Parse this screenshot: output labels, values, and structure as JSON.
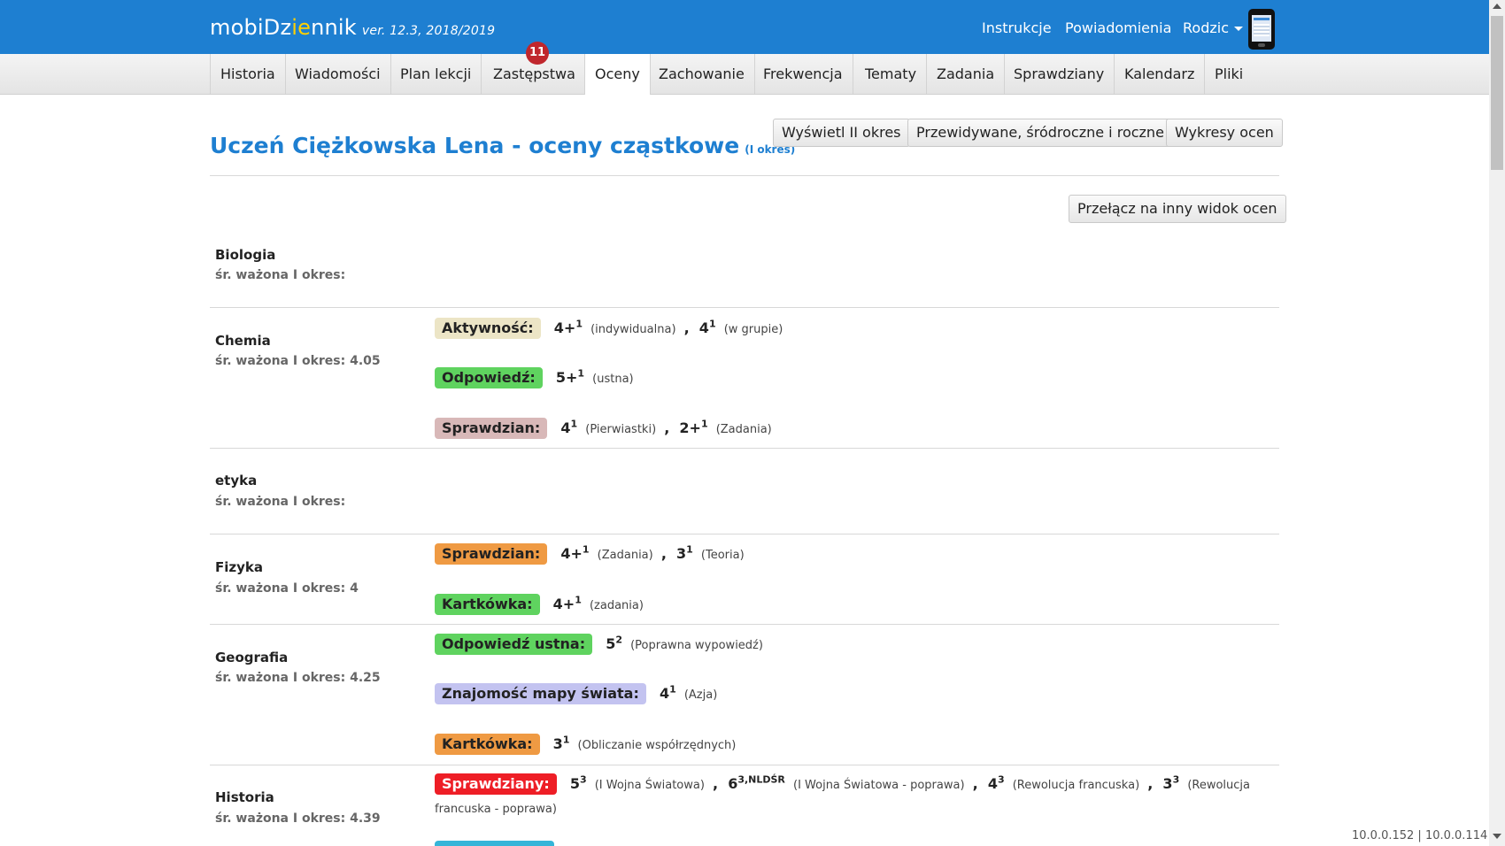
{
  "header": {
    "brand_a": "mobiDz",
    "brand_b": "ie",
    "brand_c": "nnik",
    "version": "ver. 12.3, 2018/2019",
    "links": [
      "Instrukcje",
      "Powiadomienia"
    ],
    "user_menu": "Rodzic"
  },
  "tabs": [
    "Historia",
    "Wiadomości",
    "Plan lekcji",
    "Zastępstwa",
    "Oceny",
    "Zachowanie",
    "Frekwencja",
    "Tematy",
    "Zadania",
    "Sprawdziany",
    "Kalendarz",
    "Pliki"
  ],
  "active_tab": "Oceny",
  "badge": "11",
  "page": {
    "title": "Uczeń Ciężkowska Lena - oceny cząstkowe",
    "period": "(I okres)",
    "btn_period2": "Wyświetl II okres",
    "btn_predicted": "Przewidywane, śródroczne i roczne",
    "btn_charts": "Wykresy ocen",
    "btn_switch": "Przełącz na inny widok ocen"
  },
  "subjects": [
    {
      "name": "Biologia",
      "avg": "śr. ważona I okres:"
    },
    {
      "name": "Chemia",
      "avg": "śr. ważona I okres: 4.05"
    },
    {
      "name": "etyka",
      "avg": "śr. ważona I okres:"
    },
    {
      "name": "Fizyka",
      "avg": "śr. ważona I okres: 4"
    },
    {
      "name": "Geografia",
      "avg": "śr. ważona I okres: 4.25"
    },
    {
      "name": "Historia",
      "avg": "śr. ważona I okres: 4.39"
    }
  ],
  "grades": {
    "chem_akt": {
      "cat": "Aktywność:",
      "g1": "4+",
      "w1": "1",
      "d1": "(indywidualna)",
      "g2": "4",
      "w2": "1",
      "d2": "(w grupie)"
    },
    "chem_odp": {
      "cat": "Odpowiedź:",
      "g1": "5+",
      "w1": "1",
      "d1": "(ustna)"
    },
    "chem_spr": {
      "cat": "Sprawdzian:",
      "g1": "4",
      "w1": "1",
      "d1": "(Pierwiastki)",
      "g2": "2+",
      "w2": "1",
      "d2": "(Zadania)"
    },
    "fiz_spr": {
      "cat": "Sprawdzian:",
      "g1": "4+",
      "w1": "1",
      "d1": "(Zadania)",
      "g2": "3",
      "w2": "1",
      "d2": "(Teoria)"
    },
    "fiz_kart": {
      "cat": "Kartkówka:",
      "g1": "4+",
      "w1": "1",
      "d1": "(zadania)"
    },
    "geo_odp": {
      "cat": "Odpowiedź ustna:",
      "g1": "5",
      "w1": "2",
      "d1": "(Poprawna wypowiedź)"
    },
    "geo_mapa": {
      "cat": "Znajomość mapy świata:",
      "g1": "4",
      "w1": "1",
      "d1": "(Azja)"
    },
    "geo_kart": {
      "cat": "Kartkówka:",
      "g1": "3",
      "w1": "1",
      "d1": "(Obliczanie współrzędnych)"
    },
    "hist_spr": {
      "cat": "Sprawdziany:",
      "g1": "5",
      "w1": "3",
      "d1": "(I Wojna Światowa)",
      "g2": "6",
      "w2": "3,NLDŚR",
      "d2": "(I Wojna Światowa - poprawa)",
      "g3": "4",
      "w3": "3",
      "d3": "(Rewolucja francuska)",
      "g4": "3",
      "w4": "3",
      "d4": "(Rewolucja",
      "d4b": "francuska - poprawa)"
    }
  },
  "footer_ip": "10.0.0.152 | 10.0.0.114"
}
